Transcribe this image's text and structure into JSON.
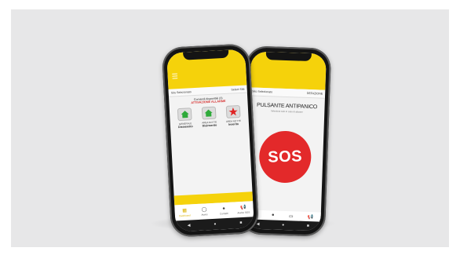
{
  "left_screen": {
    "menu_glyph": "☰",
    "site_bar": {
      "left": "Sito Selezionato",
      "right": "Select Site"
    },
    "commands": {
      "title": "Comandi disponibili (3)",
      "alarm": "ATTIVAZIONE ALLARME"
    },
    "tiles": [
      {
        "icon": "home-icon",
        "color": "#2eaa3a",
        "name": "GENERALE",
        "state": "Disinserito"
      },
      {
        "icon": "home-icon",
        "color": "#2eaa3a",
        "name": "AREA NOTTE",
        "state": "Disinserito"
      },
      {
        "icon": "star-icon",
        "color": "#e02525",
        "name": "AREA NOTTE",
        "state": "Inserito"
      }
    ],
    "tabs": [
      {
        "glyph": "▦",
        "label": "Dashboard"
      },
      {
        "glyph": "◯",
        "label": "Avvisi"
      },
      {
        "glyph": "●",
        "label": "Contatti"
      },
      {
        "glyph": "📢",
        "label": "Avviso SOS"
      }
    ],
    "nav": [
      "◀",
      "●",
      "■"
    ]
  },
  "right_screen": {
    "site_bar": {
      "left": "Sito Selezionato",
      "right": "DEFAZIONE"
    },
    "title": "PULSANTE ANTIPANICO",
    "subtitle": "Seleziona solo in caso di allarme",
    "sos_label": "SOS",
    "tabs": [
      "▤",
      "●",
      "▭",
      "📢"
    ],
    "nav": [
      "◀",
      "●",
      "■"
    ]
  },
  "colors": {
    "brand_yellow": "#f5d20b",
    "sos_red": "#e3292a",
    "backdrop": "#e7e7e8"
  }
}
